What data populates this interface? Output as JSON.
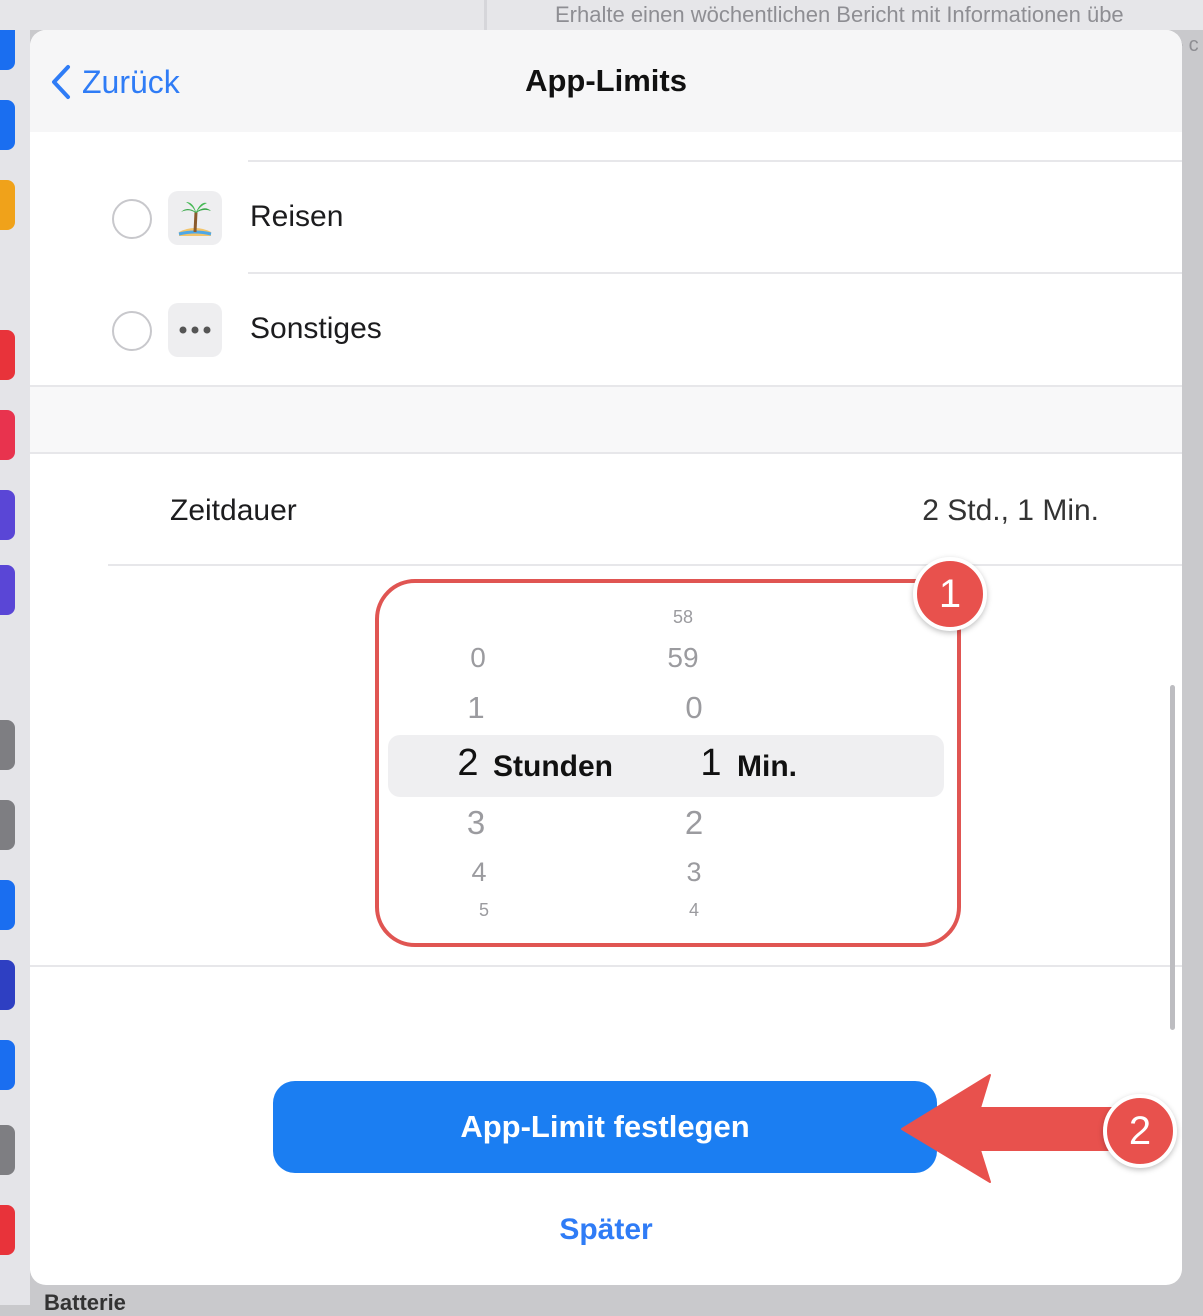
{
  "background": {
    "top_text": "Erhalte einen wöchentlichen Bericht mit Informationen übe",
    "top_text_line2": "e c",
    "bottom_text": "Batterie"
  },
  "navbar": {
    "back_label": "Zurück",
    "title": "App-Limits"
  },
  "categories": [
    {
      "label": "Reisen",
      "icon": "palm-tree-icon",
      "selected": false
    },
    {
      "label": "Sonstiges",
      "icon": "more-dots-icon",
      "selected": false
    }
  ],
  "duration": {
    "label": "Zeitdauer",
    "value": "2 Std., 1 Min."
  },
  "picker": {
    "hours_above": [
      "0",
      "1"
    ],
    "hours_selected": "2",
    "hours_below": [
      "3",
      "4",
      "5"
    ],
    "hours_unit": "Stunden",
    "minutes_above": [
      "58",
      "59",
      "0"
    ],
    "minutes_selected": "1",
    "minutes_below": [
      "2",
      "3",
      "4"
    ],
    "minutes_unit": "Min."
  },
  "annotations": {
    "badge_1": "1",
    "badge_2": "2",
    "accent_color": "#e8514d"
  },
  "actions": {
    "primary_label": "App-Limit festlegen",
    "secondary_label": "Später"
  },
  "colors": {
    "ios_blue": "#2f7cf6",
    "button_blue": "#1b7ef2"
  }
}
